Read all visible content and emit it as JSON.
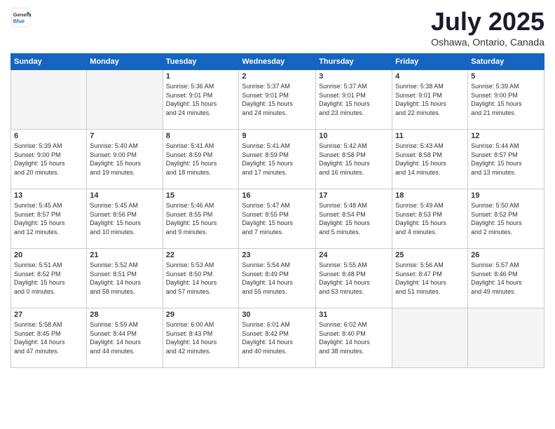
{
  "logo": {
    "general": "General",
    "blue": "Blue"
  },
  "title": "July 2025",
  "location": "Oshawa, Ontario, Canada",
  "weekdays": [
    "Sunday",
    "Monday",
    "Tuesday",
    "Wednesday",
    "Thursday",
    "Friday",
    "Saturday"
  ],
  "weeks": [
    [
      {
        "day": "",
        "info": ""
      },
      {
        "day": "",
        "info": ""
      },
      {
        "day": "1",
        "info": "Sunrise: 5:36 AM\nSunset: 9:01 PM\nDaylight: 15 hours\nand 24 minutes."
      },
      {
        "day": "2",
        "info": "Sunrise: 5:37 AM\nSunset: 9:01 PM\nDaylight: 15 hours\nand 24 minutes."
      },
      {
        "day": "3",
        "info": "Sunrise: 5:37 AM\nSunset: 9:01 PM\nDaylight: 15 hours\nand 23 minutes."
      },
      {
        "day": "4",
        "info": "Sunrise: 5:38 AM\nSunset: 9:01 PM\nDaylight: 15 hours\nand 22 minutes."
      },
      {
        "day": "5",
        "info": "Sunrise: 5:39 AM\nSunset: 9:00 PM\nDaylight: 15 hours\nand 21 minutes."
      }
    ],
    [
      {
        "day": "6",
        "info": "Sunrise: 5:39 AM\nSunset: 9:00 PM\nDaylight: 15 hours\nand 20 minutes."
      },
      {
        "day": "7",
        "info": "Sunrise: 5:40 AM\nSunset: 9:00 PM\nDaylight: 15 hours\nand 19 minutes."
      },
      {
        "day": "8",
        "info": "Sunrise: 5:41 AM\nSunset: 8:59 PM\nDaylight: 15 hours\nand 18 minutes."
      },
      {
        "day": "9",
        "info": "Sunrise: 5:41 AM\nSunset: 8:59 PM\nDaylight: 15 hours\nand 17 minutes."
      },
      {
        "day": "10",
        "info": "Sunrise: 5:42 AM\nSunset: 8:58 PM\nDaylight: 15 hours\nand 16 minutes."
      },
      {
        "day": "11",
        "info": "Sunrise: 5:43 AM\nSunset: 8:58 PM\nDaylight: 15 hours\nand 14 minutes."
      },
      {
        "day": "12",
        "info": "Sunrise: 5:44 AM\nSunset: 8:57 PM\nDaylight: 15 hours\nand 13 minutes."
      }
    ],
    [
      {
        "day": "13",
        "info": "Sunrise: 5:45 AM\nSunset: 8:57 PM\nDaylight: 15 hours\nand 12 minutes."
      },
      {
        "day": "14",
        "info": "Sunrise: 5:45 AM\nSunset: 8:56 PM\nDaylight: 15 hours\nand 10 minutes."
      },
      {
        "day": "15",
        "info": "Sunrise: 5:46 AM\nSunset: 8:55 PM\nDaylight: 15 hours\nand 9 minutes."
      },
      {
        "day": "16",
        "info": "Sunrise: 5:47 AM\nSunset: 8:55 PM\nDaylight: 15 hours\nand 7 minutes."
      },
      {
        "day": "17",
        "info": "Sunrise: 5:48 AM\nSunset: 8:54 PM\nDaylight: 15 hours\nand 5 minutes."
      },
      {
        "day": "18",
        "info": "Sunrise: 5:49 AM\nSunset: 8:53 PM\nDaylight: 15 hours\nand 4 minutes."
      },
      {
        "day": "19",
        "info": "Sunrise: 5:50 AM\nSunset: 8:52 PM\nDaylight: 15 hours\nand 2 minutes."
      }
    ],
    [
      {
        "day": "20",
        "info": "Sunrise: 5:51 AM\nSunset: 8:52 PM\nDaylight: 15 hours\nand 0 minutes."
      },
      {
        "day": "21",
        "info": "Sunrise: 5:52 AM\nSunset: 8:51 PM\nDaylight: 14 hours\nand 58 minutes."
      },
      {
        "day": "22",
        "info": "Sunrise: 5:53 AM\nSunset: 8:50 PM\nDaylight: 14 hours\nand 57 minutes."
      },
      {
        "day": "23",
        "info": "Sunrise: 5:54 AM\nSunset: 8:49 PM\nDaylight: 14 hours\nand 55 minutes."
      },
      {
        "day": "24",
        "info": "Sunrise: 5:55 AM\nSunset: 8:48 PM\nDaylight: 14 hours\nand 53 minutes."
      },
      {
        "day": "25",
        "info": "Sunrise: 5:56 AM\nSunset: 8:47 PM\nDaylight: 14 hours\nand 51 minutes."
      },
      {
        "day": "26",
        "info": "Sunrise: 5:57 AM\nSunset: 8:46 PM\nDaylight: 14 hours\nand 49 minutes."
      }
    ],
    [
      {
        "day": "27",
        "info": "Sunrise: 5:58 AM\nSunset: 8:45 PM\nDaylight: 14 hours\nand 47 minutes."
      },
      {
        "day": "28",
        "info": "Sunrise: 5:59 AM\nSunset: 8:44 PM\nDaylight: 14 hours\nand 44 minutes."
      },
      {
        "day": "29",
        "info": "Sunrise: 6:00 AM\nSunset: 8:43 PM\nDaylight: 14 hours\nand 42 minutes."
      },
      {
        "day": "30",
        "info": "Sunrise: 6:01 AM\nSunset: 8:42 PM\nDaylight: 14 hours\nand 40 minutes."
      },
      {
        "day": "31",
        "info": "Sunrise: 6:02 AM\nSunset: 8:40 PM\nDaylight: 14 hours\nand 38 minutes."
      },
      {
        "day": "",
        "info": ""
      },
      {
        "day": "",
        "info": ""
      }
    ]
  ]
}
